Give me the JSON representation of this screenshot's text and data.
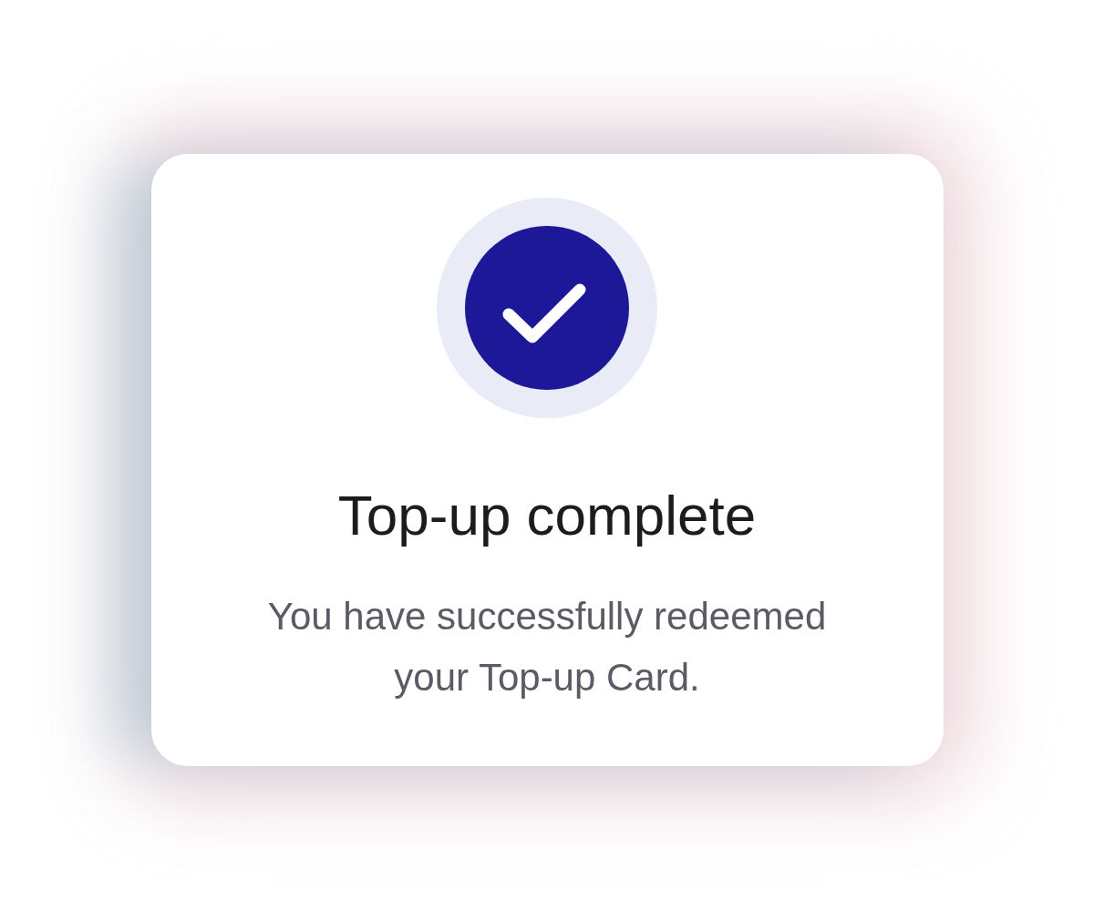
{
  "dialog": {
    "title": "Top-up complete",
    "message": "You have successfully redeemed your Top-up Card."
  }
}
